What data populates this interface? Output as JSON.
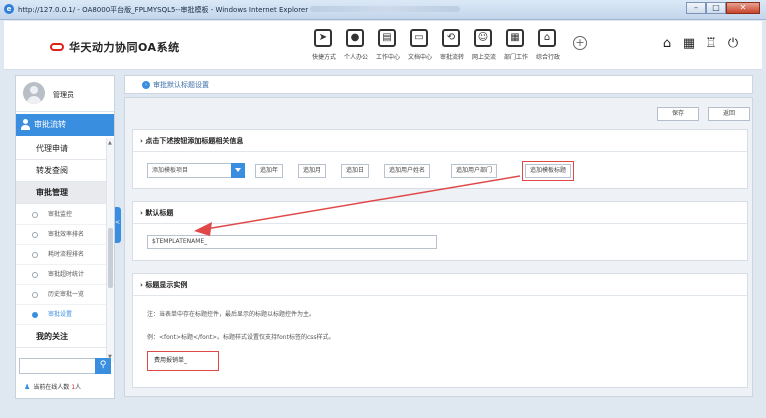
{
  "window": {
    "title": "http://127.0.0.1/ - OA8000平台版_FPLMYSQL5--审批模板 - Windows Internet Explorer",
    "ie_icon": "e",
    "min": "–",
    "max": "□",
    "close": "✕"
  },
  "header": {
    "logo_text": "华天动力协同OA系统",
    "modules": [
      {
        "label": "快捷方式",
        "icon": "send-icon",
        "glyph": "➤"
      },
      {
        "label": "个人办公",
        "icon": "person-icon",
        "glyph": "●"
      },
      {
        "label": "工作中心",
        "icon": "briefcase-icon",
        "glyph": "▤"
      },
      {
        "label": "文档中心",
        "icon": "document-icon",
        "glyph": "▭"
      },
      {
        "label": "审批流转",
        "icon": "flow-icon",
        "glyph": "⟲"
      },
      {
        "label": "网上交流",
        "icon": "chat-icon",
        "glyph": "☺"
      },
      {
        "label": "部门工作",
        "icon": "department-icon",
        "glyph": "▦"
      },
      {
        "label": "综合行政",
        "icon": "admin-icon",
        "glyph": "⌂"
      }
    ],
    "plus": "+",
    "right_icons": [
      {
        "name": "home-icon",
        "glyph": "⌂"
      },
      {
        "name": "grid-icon",
        "glyph": "▦"
      },
      {
        "name": "shirt-icon",
        "glyph": "♖"
      },
      {
        "name": "power-icon",
        "glyph": "⏻"
      }
    ]
  },
  "sidebar": {
    "user_name": "管理员",
    "section_title": "审批流转",
    "menu": [
      {
        "label": "代理申请"
      },
      {
        "label": "转发查阅"
      },
      {
        "label": "审批管理"
      }
    ],
    "submenu": [
      {
        "label": "审批监控"
      },
      {
        "label": "审批效率排名"
      },
      {
        "label": "耗时流程排名"
      },
      {
        "label": "审批超时统计"
      },
      {
        "label": "历史审批一览"
      },
      {
        "label": "审批设置"
      }
    ],
    "my_follow": "我的关注",
    "online_label": "当前在线人数",
    "online_count": "1",
    "online_unit": "人",
    "search_glyph": "⚲"
  },
  "breadcrumb": {
    "icon_glyph": "›",
    "text": "审批默认标题设置"
  },
  "toolbar": {
    "save": "保存",
    "back": "返回"
  },
  "panel_info": {
    "title": "› 点击下述按钮添加标题相关信息",
    "select_value": "添加模板项目",
    "buttons": [
      "追加年",
      "追加月",
      "追加日",
      "追加用户姓名",
      "追加用户部门",
      "追加模板标题"
    ]
  },
  "panel_default": {
    "title": "› 默认标题",
    "input_value": "$TEMPLATENAME_"
  },
  "panel_example": {
    "title": "› 标题显示实例",
    "note1": "注：当表单中存在标题控件，最后显示的标题以标题控件为主。",
    "note2": "例：<font>标题</font>。标题样式设置仅支持font标签的css样式。",
    "sample": "费用报销单_"
  },
  "accent": "#3a8ee0",
  "highlight": "#e04848"
}
